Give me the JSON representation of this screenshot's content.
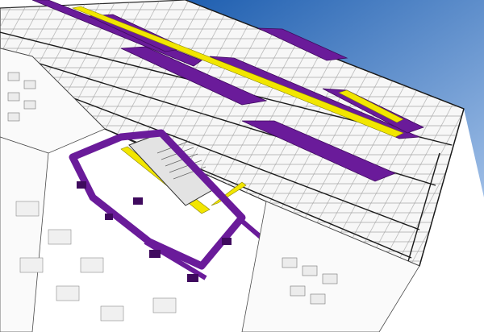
{
  "colors": {
    "sky_top": "#1f5fb0",
    "sky_bottom": "#9dbde6",
    "slab": "#f3f3f3",
    "slab_shadow": "#d9d9d9",
    "line": "#2a2a2a",
    "duct": "#6a1b9a",
    "duct_dark": "#3f0a5e",
    "cable_tray": "#f2e600"
  },
  "icons": [
    "building-model-icon"
  ]
}
